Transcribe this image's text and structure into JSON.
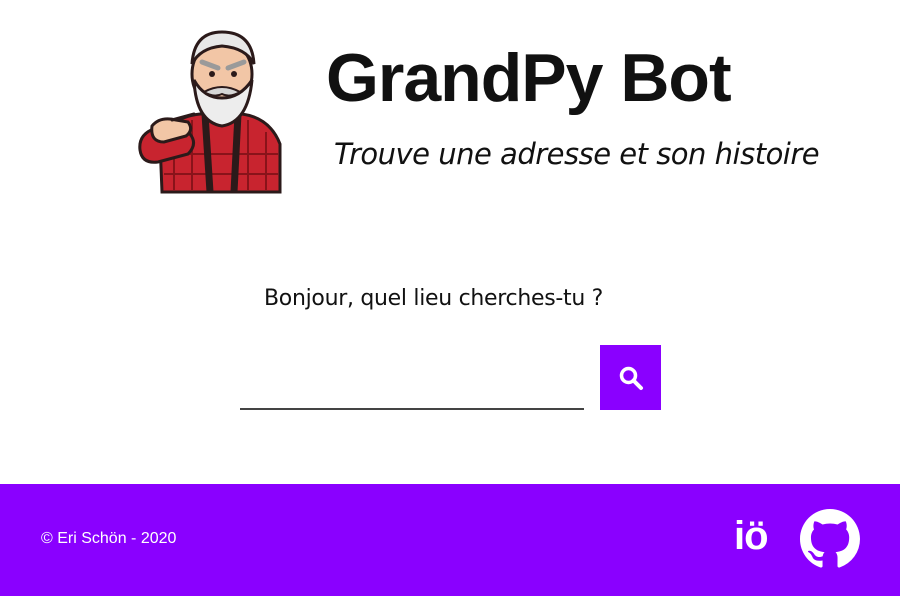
{
  "header": {
    "title": "GrandPy Bot",
    "subtitle": "Trouve une adresse et son histoire"
  },
  "search": {
    "prompt": "Bonjour, quel lieu cherches-tu ?",
    "value": "",
    "placeholder": ""
  },
  "footer": {
    "copyright": "© Eri Schön - 2020",
    "io_label": "iö"
  },
  "colors": {
    "accent": "#8a00ff",
    "text": "#111111",
    "footer_text": "#ffffff"
  },
  "icons": {
    "search": "search-icon",
    "github": "github-icon",
    "mascot": "grandpa-mascot-illustration"
  }
}
